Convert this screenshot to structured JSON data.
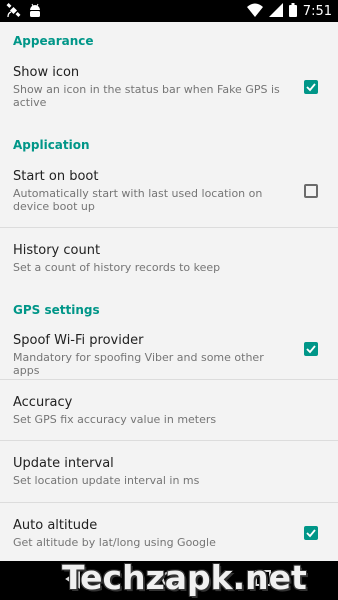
{
  "status_bar": {
    "time": "7:51",
    "icons": [
      "satellite-icon",
      "android-icon",
      "wifi-icon",
      "signal-icon",
      "battery-icon"
    ]
  },
  "settings": {
    "appearance": {
      "header": "Appearance",
      "show_icon": {
        "title": "Show icon",
        "summary": "Show an icon in the status bar when Fake GPS is active",
        "checked": true
      }
    },
    "application": {
      "header": "Application",
      "start_on_boot": {
        "title": "Start on boot",
        "summary": "Automatically start with last used location on device boot up",
        "checked": false
      },
      "history_count": {
        "title": "History count",
        "summary": "Set a count of history records to keep"
      }
    },
    "gps": {
      "header": "GPS settings",
      "spoof_wifi": {
        "title": "Spoof Wi-Fi provider",
        "summary": "Mandatory for spoofing Viber and some other apps",
        "checked": true
      },
      "accuracy": {
        "title": "Accuracy",
        "summary": "Set GPS fix accuracy value in meters"
      },
      "update_interval": {
        "title": "Update interval",
        "summary": "Set location update interval in ms"
      },
      "auto_altitude": {
        "title": "Auto altitude",
        "summary": "Get altitude by lat/long using Google",
        "checked": true
      }
    }
  },
  "watermark": "Techzapk.net",
  "colors": {
    "accent": "#009688",
    "background": "#f3f3f3",
    "bar": "#000000"
  }
}
